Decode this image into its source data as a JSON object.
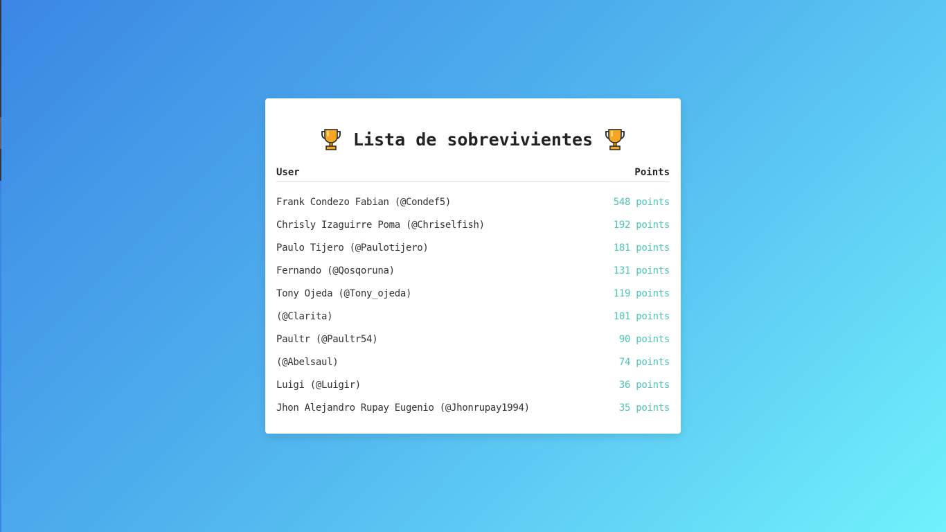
{
  "leaderboard": {
    "title": "Lista de sobrevivientes",
    "icon_left": "trophy-icon",
    "icon_right": "trophy-icon",
    "columns": {
      "user": "User",
      "points": "Points"
    },
    "rows": [
      {
        "user": "Frank Condezo Fabian (@Condef5)",
        "points": "548 points"
      },
      {
        "user": "Chrisly Izaguirre Poma (@Chriselfish)",
        "points": "192 points"
      },
      {
        "user": "Paulo Tijero (@Paulotijero)",
        "points": "181 points"
      },
      {
        "user": "Fernando (@Qosqoruna)",
        "points": "131 points"
      },
      {
        "user": "Tony Ojeda (@Tony_ojeda)",
        "points": "119 points"
      },
      {
        "user": "(@Clarita)",
        "points": "101 points"
      },
      {
        "user": "Paultr (@Paultr54)",
        "points": "90 points"
      },
      {
        "user": "(@Abelsaul)",
        "points": "74 points"
      },
      {
        "user": "Luigi (@Luigir)",
        "points": "36 points"
      },
      {
        "user": "Jhon Alejandro Rupay Eugenio (@Jhonrupay1994)",
        "points": "35 points"
      }
    ]
  },
  "colors": {
    "background_start": "#3b87e4",
    "background_end": "#70f1fc",
    "points_text": "#4fc4b7",
    "trophy_gold": "#f5a623"
  }
}
